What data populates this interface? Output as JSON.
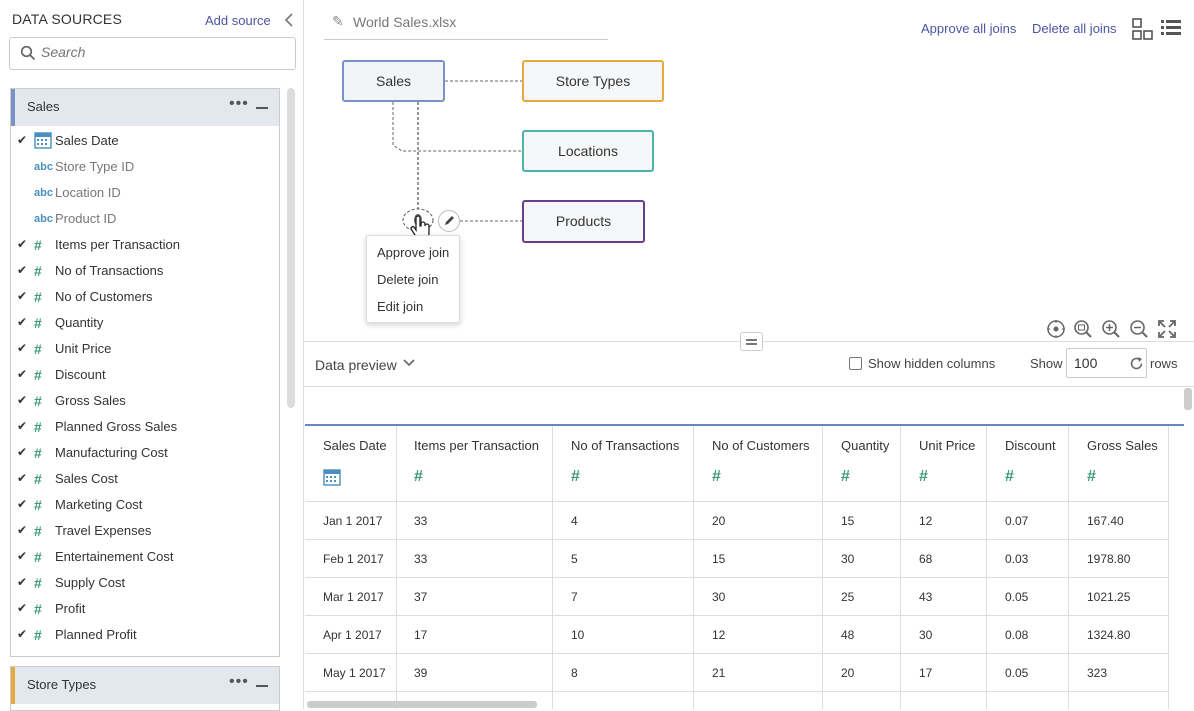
{
  "sidebar": {
    "header": "DATA SOURCES",
    "add_source": "Add source",
    "search_placeholder": "Search",
    "panels": [
      {
        "title": "Sales",
        "fields": [
          {
            "name": "Sales Date",
            "type": "date",
            "checked": true
          },
          {
            "name": "Store Type ID",
            "type": "abc",
            "checked": false
          },
          {
            "name": "Location ID",
            "type": "abc",
            "checked": false
          },
          {
            "name": "Product ID",
            "type": "abc",
            "checked": false
          },
          {
            "name": "Items per Transaction",
            "type": "#",
            "checked": true
          },
          {
            "name": "No of Transactions",
            "type": "#",
            "checked": true
          },
          {
            "name": "No of Customers",
            "type": "#",
            "checked": true
          },
          {
            "name": "Quantity",
            "type": "#",
            "checked": true
          },
          {
            "name": "Unit Price",
            "type": "#",
            "checked": true
          },
          {
            "name": "Discount",
            "type": "#",
            "checked": true
          },
          {
            "name": "Gross Sales",
            "type": "#",
            "checked": true
          },
          {
            "name": "Planned Gross Sales",
            "type": "#",
            "checked": true
          },
          {
            "name": "Manufacturing Cost",
            "type": "#",
            "checked": true
          },
          {
            "name": "Sales Cost",
            "type": "#",
            "checked": true
          },
          {
            "name": "Marketing Cost",
            "type": "#",
            "checked": true
          },
          {
            "name": "Travel Expenses",
            "type": "#",
            "checked": true
          },
          {
            "name": "Entertainement Cost",
            "type": "#",
            "checked": true
          },
          {
            "name": "Supply Cost",
            "type": "#",
            "checked": true
          },
          {
            "name": "Profit",
            "type": "#",
            "checked": true
          },
          {
            "name": "Planned Profit",
            "type": "#",
            "checked": true
          }
        ]
      },
      {
        "title": "Store Types",
        "fields": []
      }
    ]
  },
  "main": {
    "file_name": "World Sales.xlsx",
    "approve_all": "Approve all joins",
    "delete_all": "Delete all joins",
    "nodes": {
      "sales": "Sales",
      "store_types": "Store Types",
      "locations": "Locations",
      "products": "Products"
    },
    "node_colors": {
      "sales": "#7b92c9",
      "store_types": "#e6a93f",
      "locations": "#4fb3ad",
      "products": "#6b3d8f"
    },
    "context_menu": [
      "Approve join",
      "Delete join",
      "Edit join"
    ],
    "preview": {
      "label": "Data preview",
      "show_hidden": "Show hidden columns",
      "show": "Show",
      "rows_value": "100",
      "rows": "rows"
    },
    "table": {
      "columns": [
        {
          "name": "Sales Date",
          "type": "date"
        },
        {
          "name": "Items per Transaction",
          "type": "#"
        },
        {
          "name": "No of Transactions",
          "type": "#"
        },
        {
          "name": "No of Customers",
          "type": "#"
        },
        {
          "name": "Quantity",
          "type": "#"
        },
        {
          "name": "Unit Price",
          "type": "#"
        },
        {
          "name": "Discount",
          "type": "#"
        },
        {
          "name": "Gross Sales",
          "type": "#"
        }
      ],
      "rows": [
        [
          "Jan 1 2017",
          "33",
          "4",
          "20",
          "15",
          "12",
          "0.07",
          "167.40"
        ],
        [
          "Feb 1 2017",
          "33",
          "5",
          "15",
          "30",
          "68",
          "0.03",
          "1978.80"
        ],
        [
          "Mar 1 2017",
          "37",
          "7",
          "30",
          "25",
          "43",
          "0.05",
          "1021.25"
        ],
        [
          "Apr 1 2017",
          "17",
          "10",
          "12",
          "48",
          "30",
          "0.08",
          "1324.80"
        ],
        [
          "May 1 2017",
          "39",
          "8",
          "21",
          "20",
          "17",
          "0.05",
          "323"
        ]
      ]
    }
  }
}
